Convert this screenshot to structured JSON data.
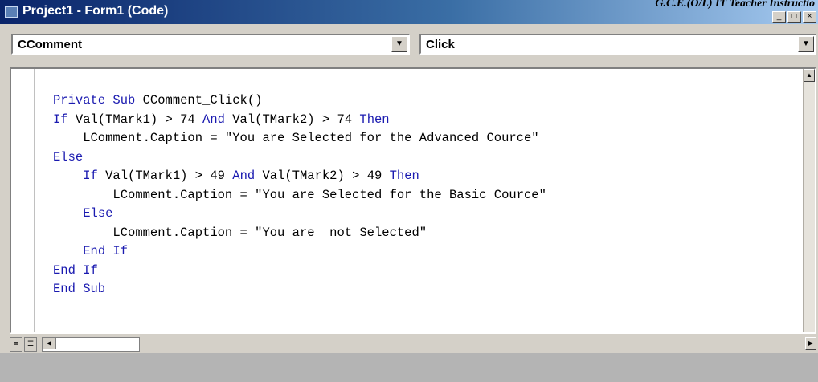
{
  "window": {
    "title": "Project1 - Form1 (Code)",
    "watermark": "G.C.E.(O/L) IT Teacher Instructio"
  },
  "object_combo": {
    "value": "CComment"
  },
  "procedure_combo": {
    "value": "Click"
  },
  "code_lines": [
    [
      {
        "t": "Private Sub ",
        "kw": true
      },
      {
        "t": "CComment_Click()",
        "kw": false
      }
    ],
    [
      {
        "t": "If ",
        "kw": true
      },
      {
        "t": "Val(TMark1) > 74 ",
        "kw": false
      },
      {
        "t": "And",
        "kw": true
      },
      {
        "t": " Val(TMark2) > 74 ",
        "kw": false
      },
      {
        "t": "Then",
        "kw": true
      }
    ],
    [
      {
        "t": "    LComment.Caption = \"You are Selected for the Advanced Cource\"",
        "kw": false
      }
    ],
    [
      {
        "t": "Else",
        "kw": true
      }
    ],
    [
      {
        "t": "    ",
        "kw": false
      },
      {
        "t": "If ",
        "kw": true
      },
      {
        "t": "Val(TMark1) > 49 ",
        "kw": false
      },
      {
        "t": "And",
        "kw": true
      },
      {
        "t": " Val(TMark2) > 49 ",
        "kw": false
      },
      {
        "t": "Then",
        "kw": true
      }
    ],
    [
      {
        "t": "        LComment.Caption = \"You are Selected for the Basic Cource\"",
        "kw": false
      }
    ],
    [
      {
        "t": "    ",
        "kw": false
      },
      {
        "t": "Else",
        "kw": true
      }
    ],
    [
      {
        "t": "        LComment.Caption = \"You are  not Selected\"",
        "kw": false
      }
    ],
    [
      {
        "t": "    ",
        "kw": false
      },
      {
        "t": "End If",
        "kw": true
      }
    ],
    [
      {
        "t": "End If",
        "kw": true
      }
    ],
    [
      {
        "t": "End Sub",
        "kw": true
      }
    ]
  ]
}
